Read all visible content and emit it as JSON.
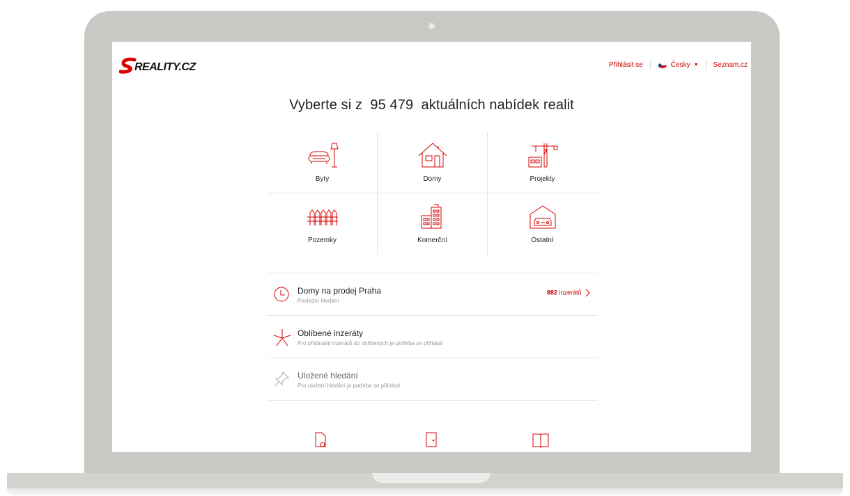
{
  "brand": {
    "logo_text": "SREALITY.CZ",
    "accent": "#cc0000"
  },
  "topnav": {
    "login": "Přihlásit se",
    "language": "Česky",
    "portal": "Seznam.cz"
  },
  "headline": {
    "prefix": "Vyberte si z",
    "count": "95 479",
    "suffix": "aktuálních nabídek realit"
  },
  "categories": [
    {
      "label": "Byty",
      "icon": "armchair-lamp-icon"
    },
    {
      "label": "Domy",
      "icon": "house-icon"
    },
    {
      "label": "Projekty",
      "icon": "crane-icon"
    },
    {
      "label": "Pozemky",
      "icon": "fence-icon"
    },
    {
      "label": "Komerční",
      "icon": "office-building-icon"
    },
    {
      "label": "Ostatní",
      "icon": "garage-car-icon"
    }
  ],
  "list": [
    {
      "title": "Domy na prodej Praha",
      "subtitle": "Poslední hledání",
      "count": "882",
      "count_suffix": "inzerátů",
      "icon": "clock-icon"
    },
    {
      "title": "Oblíbené inzeráty",
      "subtitle": "Pro přidávání inzerátů do oblíbených je potřeba se přihlásit",
      "icon": "star-icon"
    },
    {
      "title": "Uložené hledání",
      "subtitle": "Pro uložení hledání je potřeba se přihlásit",
      "icon": "pin-icon"
    }
  ]
}
